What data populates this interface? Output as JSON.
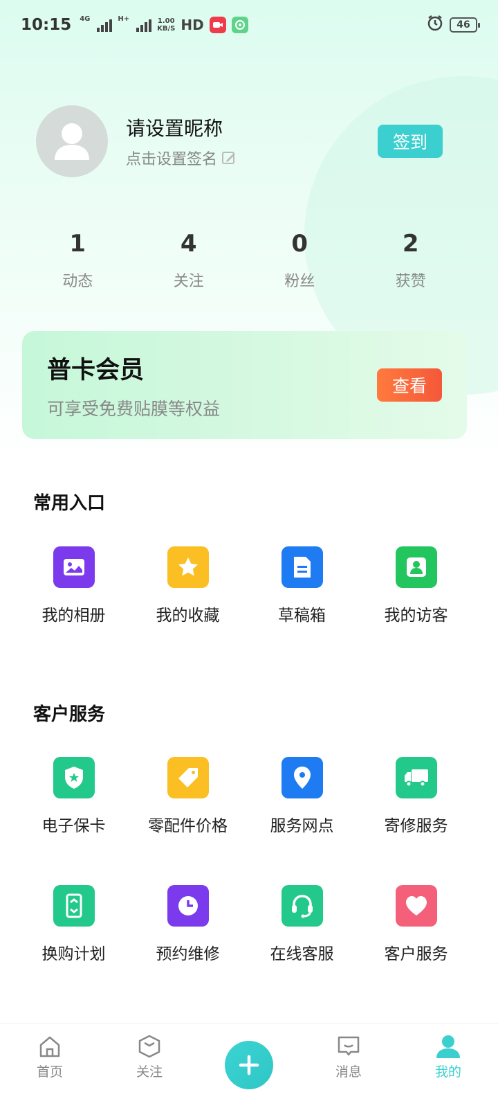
{
  "status_bar": {
    "time": "10:15",
    "net1": "4G",
    "net2": "H+",
    "speed_top": "1.00",
    "speed_bottom": "KB/S",
    "hd": "HD",
    "battery": "46"
  },
  "profile": {
    "nickname": "请设置昵称",
    "signature": "点击设置签名",
    "checkin_label": "签到"
  },
  "stats": [
    {
      "num": "1",
      "label": "动态"
    },
    {
      "num": "4",
      "label": "关注"
    },
    {
      "num": "0",
      "label": "粉丝"
    },
    {
      "num": "2",
      "label": "获赞"
    }
  ],
  "member": {
    "title": "普卡会员",
    "subtitle": "可享受免费贴膜等权益",
    "view_label": "查看"
  },
  "common": {
    "title": "常用入口",
    "items": [
      {
        "label": "我的相册",
        "icon": "photo-album-icon",
        "color": "#7c3aed"
      },
      {
        "label": "我的收藏",
        "icon": "star-icon",
        "color": "#fbbf24"
      },
      {
        "label": "草稿箱",
        "icon": "document-icon",
        "color": "#1e7bf2"
      },
      {
        "label": "我的访客",
        "icon": "person-icon",
        "color": "#22c55e"
      }
    ]
  },
  "service": {
    "title": "客户服务",
    "items": [
      {
        "label": "电子保卡",
        "icon": "shield-star-icon",
        "color": "#22c98a"
      },
      {
        "label": "零配件价格",
        "icon": "price-tag-icon",
        "color": "#fbbf24"
      },
      {
        "label": "服务网点",
        "icon": "location-pin-icon",
        "color": "#1e7bf2"
      },
      {
        "label": "寄修服务",
        "icon": "truck-icon",
        "color": "#22c98a"
      },
      {
        "label": "换购计划",
        "icon": "phone-swap-icon",
        "color": "#22c98a"
      },
      {
        "label": "预约维修",
        "icon": "clock-icon",
        "color": "#7c3aed"
      },
      {
        "label": "在线客服",
        "icon": "headset-icon",
        "color": "#22c98a"
      },
      {
        "label": "客户服务",
        "icon": "heart-icon",
        "color": "#f4607a"
      }
    ]
  },
  "nav": {
    "home": "首页",
    "follow": "关注",
    "messages": "消息",
    "mine": "我的",
    "accent": "#3bd0cf"
  }
}
